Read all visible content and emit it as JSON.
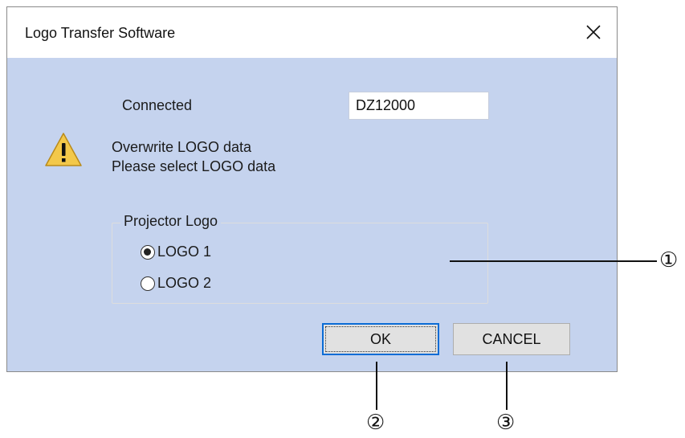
{
  "window": {
    "title": "Logo Transfer Software",
    "close_icon": "close-icon"
  },
  "colors": {
    "client_bg": "#c5d3ee",
    "ok_border": "#0a6cd6",
    "button_bg": "#e1e1e1",
    "warning_fill": "#f3c84a"
  },
  "connection": {
    "label": "Connected",
    "model": "DZ12000"
  },
  "message": {
    "icon": "warning-icon",
    "line1": "Overwrite LOGO data",
    "line2": "Please select LOGO data"
  },
  "logo_group": {
    "legend": "Projector Logo",
    "options": [
      {
        "label": "LOGO 1",
        "selected": true
      },
      {
        "label": "LOGO 2",
        "selected": false
      }
    ]
  },
  "buttons": {
    "ok": "OK",
    "cancel": "CANCEL"
  },
  "callouts": {
    "one": "①",
    "two": "②",
    "three": "③"
  }
}
